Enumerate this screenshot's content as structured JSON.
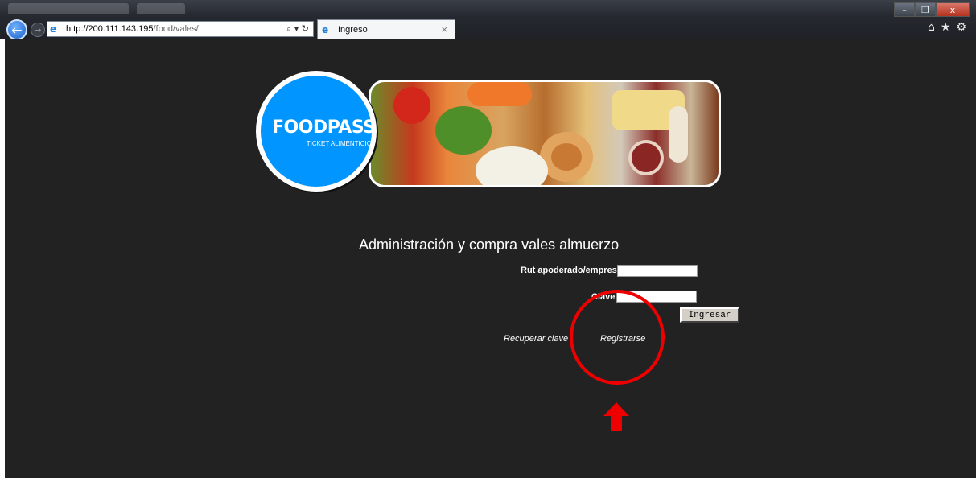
{
  "browser": {
    "url_host": "http://200.111.143.195",
    "url_path": "/food/vales/",
    "address_tools": "⌕ ▾ ↻",
    "tab_title": "Ingreso",
    "tab_close": "×",
    "window_controls": [
      "–",
      "❐",
      "x"
    ],
    "right_icons": [
      "⌂",
      "★",
      "⚙"
    ],
    "back_icon": "←",
    "forward_icon": "→"
  },
  "logo": {
    "title": "FOODPASS",
    "subtitle": "TICKET ALIMENTICIO",
    "brand_color": "#0095ff"
  },
  "form": {
    "heading": "Administración y compra vales almuerzo",
    "rut_label": "Rut apoderado/empresa",
    "clave_label": "Clave",
    "submit_label": "Ingresar",
    "recover_link": "Recuperar clave",
    "register_link": "Registrarse"
  },
  "colors": {
    "page_background": "#222222",
    "annotation": "#ee0000"
  }
}
